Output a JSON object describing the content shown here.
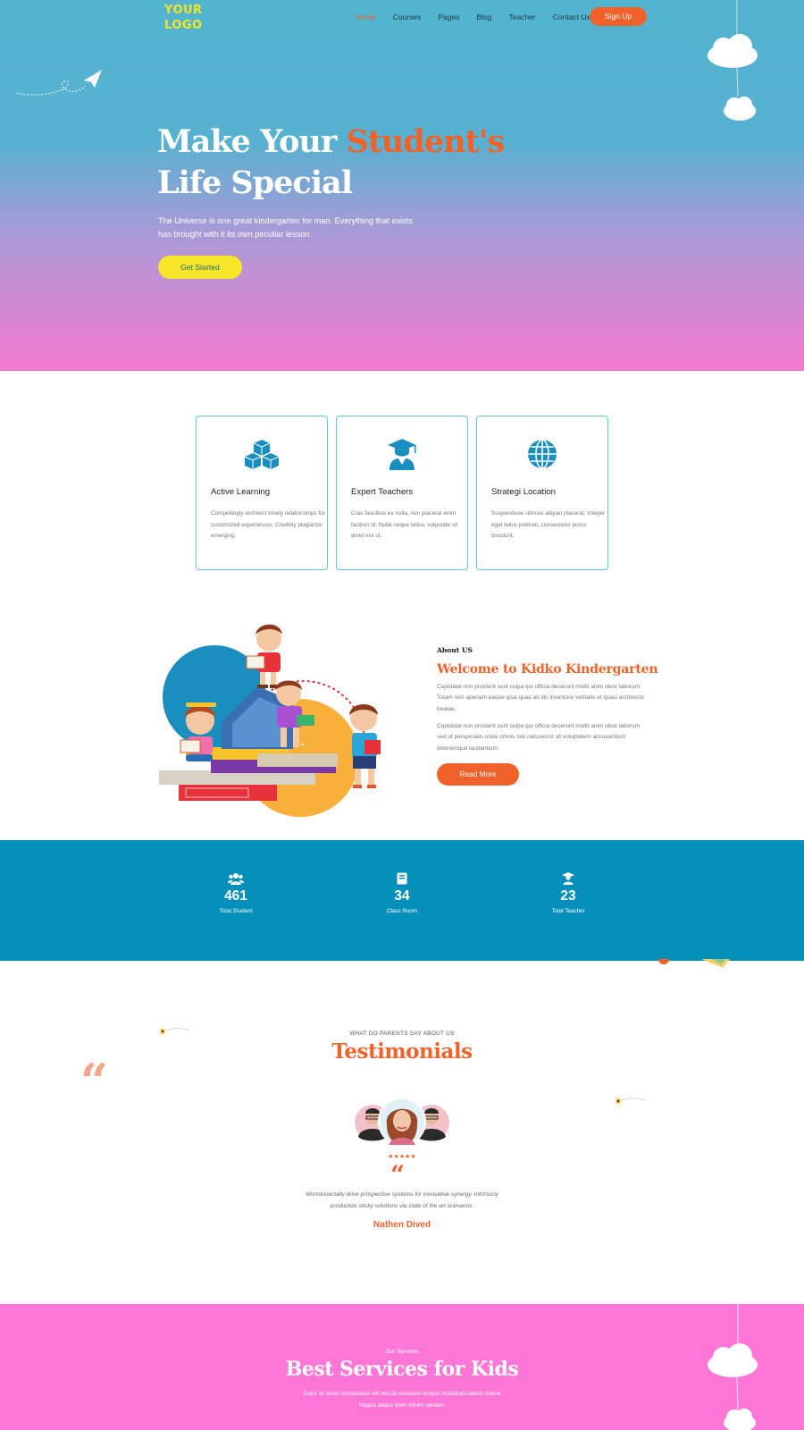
{
  "header": {
    "logo_line1": "YOUR",
    "logo_line2": "LOGO",
    "nav": [
      "Home",
      "Courses",
      "Pages",
      "Blog",
      "Teacher",
      "Contact Us"
    ],
    "signup_label": "Sign Up"
  },
  "hero": {
    "title_part1": "Make Your ",
    "title_highlight": "Student's",
    "title_part2": "Life Special",
    "description": "The Universe is one great kindergarten for man. Everything that exists has brought with it its own peculiar lesson.",
    "cta_label": "Get Started"
  },
  "features": [
    {
      "icon": "cubes-icon",
      "title": "Active Learning",
      "text": "Compellingly architect timely relationships for customized experiences. Credibly plagiarize emerging."
    },
    {
      "icon": "graduate-icon",
      "title": "Expert Teachers",
      "text": "Cras faucibus ex nulla, non placerat enim facilisis id. Nulla neque tellus, vulputate sit amet nisi ut."
    },
    {
      "icon": "globe-icon",
      "title": "Strategi Location",
      "text": "Suspendisse ultrices aliquet placerat. Integer eget tellus pretium, consectetur purus tincidunt."
    }
  ],
  "about": {
    "label": "About US",
    "title": "Welcome to Kidko Kindergarten",
    "para1": "Cupidatat non proident sunt culpa qui officia deserunt mollit anim idest laborum. Totam rem aperiam eaque ipsa quae ab illo inventore veritatis et quasi architecto beatae.",
    "para2": "Cupidatat non proident sunt culpa qui officia deserunt mollit anim idest laborum sed ut perspiciatis unde omnis iste natuserror sit voluptatem accusantium doloremque laudantium.",
    "cta_label": "Read More"
  },
  "stats": [
    {
      "icon": "users-icon",
      "value": "461",
      "label": "Total Student"
    },
    {
      "icon": "book-icon",
      "value": "34",
      "label": "Class Room"
    },
    {
      "icon": "teacher-icon",
      "value": "23",
      "label": "Total Teacher"
    }
  ],
  "testimonials": {
    "subtitle": "WHAT DO PARENTS SAY ABOUT US",
    "title": "Testimonials",
    "stars": "★★★★★",
    "rating": 5,
    "text": "Monotonectally drive prospective systems for innovative synergy. Intrinsicly productize sticky solutions via state of the art scenarios.",
    "name": "Nathen Dived"
  },
  "services": {
    "subtitle": "Our Services",
    "title": "Best Services for Kids",
    "description": "Dolor sit amet consectetur elit sed do eiusmod tempor incididunt labore dolore magna aliqua enim minim veniam."
  },
  "colors": {
    "accent": "#f0622a",
    "hero_top": "#52b4cf",
    "hero_bottom": "#f57ad0",
    "card_border": "#5ec9dc",
    "stats_bg": "#058fbb",
    "services_bg": "#ff77d6",
    "logo": "#f5e61d",
    "cta_yellow": "#f7e52a"
  }
}
